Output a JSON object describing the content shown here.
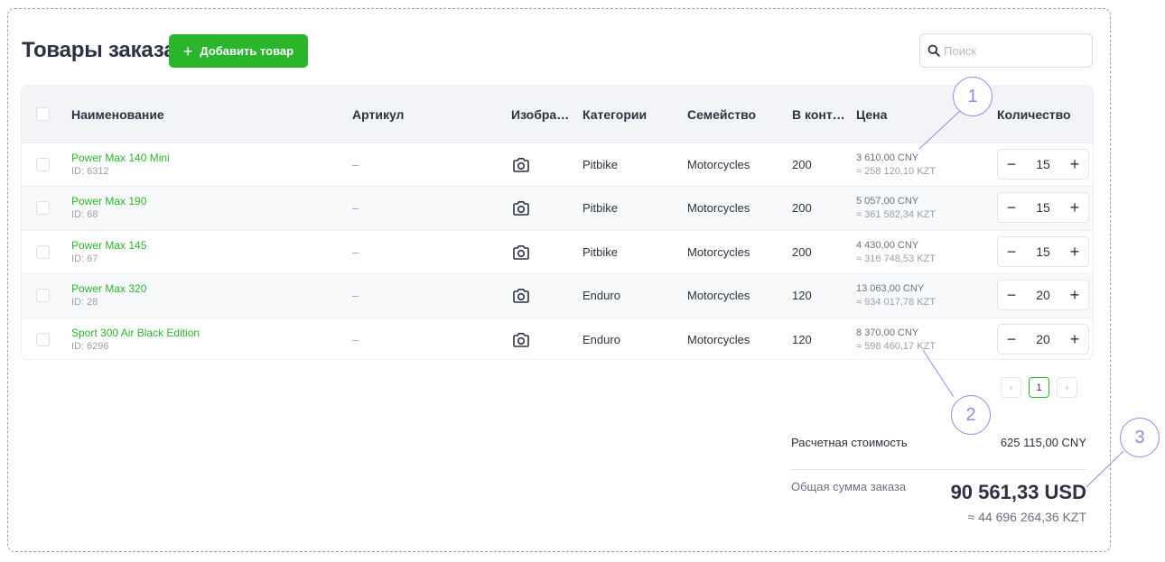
{
  "header": {
    "title": "Товары заказа",
    "add_button": "Добавить товар",
    "search_placeholder": "Поиск"
  },
  "table": {
    "columns": [
      "Наименование",
      "Артикул",
      "Изобра…",
      "Категории",
      "Семейство",
      "В конт…",
      "Цена",
      "Количество"
    ],
    "rows": [
      {
        "name": "Power Max 140 Mini",
        "id": "ID: 6312",
        "article": "–",
        "category": "Pitbike",
        "family": "Motorcycles",
        "container": "200",
        "price": "3 610,00 CNY",
        "price_kzt": "≈ 258 120,10 KZT",
        "qty": "15"
      },
      {
        "name": "Power Max 190",
        "id": "ID: 68",
        "article": "–",
        "category": "Pitbike",
        "family": "Motorcycles",
        "container": "200",
        "price": "5 057,00 CNY",
        "price_kzt": "≈ 361 582,34 KZT",
        "qty": "15"
      },
      {
        "name": "Power Max 145",
        "id": "ID: 67",
        "article": "–",
        "category": "Pitbike",
        "family": "Motorcycles",
        "container": "200",
        "price": "4 430,00 CNY",
        "price_kzt": "≈ 316 748,53 KZT",
        "qty": "15"
      },
      {
        "name": "Power Max 320",
        "id": "ID: 28",
        "article": "–",
        "category": "Enduro",
        "family": "Motorcycles",
        "container": "120",
        "price": "13 063,00 CNY",
        "price_kzt": "≈ 934 017,78 KZT",
        "qty": "20"
      },
      {
        "name": "Sport 300 Air Black Edition",
        "id": "ID: 6296",
        "article": "–",
        "category": "Enduro",
        "family": "Motorcycles",
        "container": "120",
        "price": "8 370,00 CNY",
        "price_kzt": "≈ 598 460,17 KZT",
        "qty": "20"
      }
    ]
  },
  "pagination": {
    "prev": "‹",
    "page": "1",
    "next": "›"
  },
  "summary": {
    "calc_label": "Расчетная стоимость",
    "calc_value": "625 115,00 CNY",
    "total_label": "Общая сумма заказа",
    "total_value": "90 561,33 USD",
    "total_kzt": "≈ 44 696 264,36 KZT"
  },
  "callouts": [
    "1",
    "2",
    "3"
  ],
  "colors": {
    "accent": "#2bb52c",
    "callout": "#9b87e5",
    "text": "#2d3142"
  },
  "icons": {
    "add": "plus-icon",
    "search": "search-icon",
    "image": "camera-icon"
  }
}
